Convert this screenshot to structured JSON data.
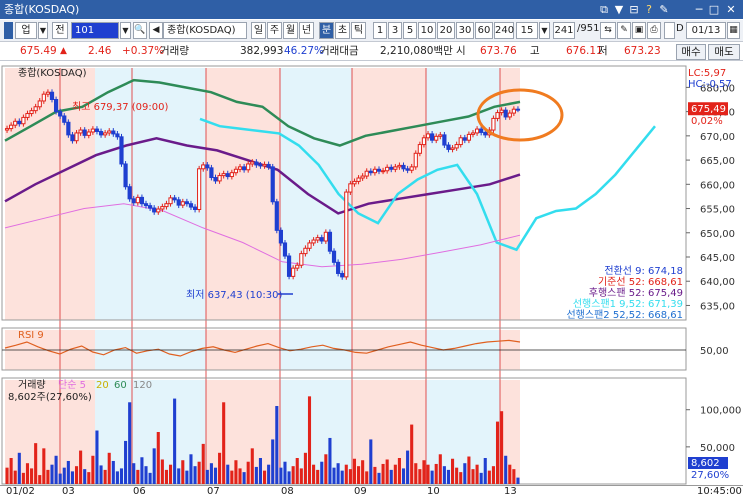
{
  "window": {
    "title": "종합(KOSDAQ)",
    "controls": [
      "⧉",
      "▼",
      "⊟",
      "?",
      "✎",
      "─",
      "□",
      "✕"
    ]
  },
  "toolbar": {
    "market": "업",
    "jeon": "전",
    "code": "101",
    "search_icon": "🔍",
    "name": "종합(KOSDAQ)",
    "periods": [
      "일",
      "주",
      "월",
      "년",
      "분",
      "초",
      "틱"
    ],
    "selected_period": "분",
    "intervals": [
      "1",
      "3",
      "5",
      "10",
      "20",
      "30",
      "60",
      "240"
    ],
    "interval_value": "15",
    "count_value": "241",
    "count_total": "/951",
    "checkbox_label": "D",
    "date_value": "01/13"
  },
  "quote": {
    "price": "675.49",
    "arrow": "▲",
    "change": "2.46",
    "change_pct": "+0.37%",
    "volume_label": "거래량",
    "volume": "382,993",
    "volume_ratio": "46.27%",
    "amount_label": "거래대금",
    "amount": "2,210,080백만",
    "open_label": "시",
    "open": "673.76",
    "high_label": "고",
    "high": "676.11",
    "low_label": "저",
    "low": "673.23",
    "buy_label": "매수",
    "sell_label": "매도"
  },
  "chart_data": [
    {
      "type": "candlestick",
      "title": "종합(KOSDAQ)",
      "ylim": [
        632,
        684
      ],
      "y_ticks": [
        "680,00",
        "675,00",
        "670,00",
        "665,00",
        "660,00",
        "655,00",
        "650,00",
        "645,00",
        "640,00",
        "635,00"
      ],
      "y_tick_values": [
        680,
        675,
        670,
        665,
        660,
        655,
        650,
        645,
        640,
        635
      ],
      "price_tag": "675,49",
      "price_tag_pct": "0,02%",
      "corner_labels": [
        "LC:5,97",
        "HC:-0,57"
      ],
      "annotations": {
        "high": "최고 679,37 (09:00)",
        "low": "최저 637,43 (10:30)"
      },
      "legend": [
        {
          "text": "전환선 9: 674,18",
          "color": "#1f3fd0"
        },
        {
          "text": "기준선 52: 668,61",
          "color": "#e2231a"
        },
        {
          "text": "후행스팬 52: 675,49",
          "color": "#6a1b8a"
        },
        {
          "text": "선행스팬1 9,52: 671,39",
          "color": "#33ddee"
        },
        {
          "text": "선행스팬2 52,52: 668,61",
          "color": "#1f6fd0"
        }
      ],
      "series": [
        {
          "name": "캔들",
          "values": [
            671.5,
            672.2,
            673.0,
            672.5,
            673.8,
            674.6,
            675.2,
            676.0,
            677.2,
            678.6,
            679.0,
            677.5,
            675.0,
            674.1,
            672.8,
            670.2,
            669.0,
            670.6,
            671.2,
            670.1,
            670.8,
            671.4,
            670.9,
            670.2,
            670.6,
            671.0,
            670.4,
            669.8,
            664.2,
            659.5,
            657.0,
            656.2,
            657.3,
            656.0,
            655.6,
            655.1,
            654.3,
            654.9,
            655.4,
            656.0,
            657.2,
            656.8,
            655.7,
            656.4,
            656.0,
            655.3,
            654.8,
            663.2,
            664.0,
            663.4,
            661.4,
            660.7,
            661.8,
            662.2,
            661.6,
            662.4,
            663.1,
            663.6,
            663.0,
            664.2,
            664.6,
            664.0,
            663.8,
            664.1,
            663.6,
            656.4,
            650.5,
            647.9,
            645.2,
            641.0,
            642.7,
            643.3,
            645.7,
            646.8,
            647.9,
            648.5,
            649.0,
            648.3,
            650.1,
            646.2,
            643.9,
            641.6,
            640.9,
            658.4,
            660.1,
            660.6,
            661.3,
            661.7,
            662.7,
            662.4,
            663.1,
            662.7,
            662.8,
            663.5,
            663.1,
            663.6,
            663.9,
            663.2,
            662.9,
            663.6,
            666.4,
            668.2,
            669.6,
            670.4,
            669.1,
            669.9,
            670.2,
            668.1,
            667.2,
            667.5,
            668.2,
            669.6,
            669.1,
            670.3,
            670.6,
            671.4,
            670.7,
            670.2,
            671.2,
            673.6,
            674.8,
            675.3,
            673.9,
            674.7,
            675.5,
            675.49
          ]
        },
        {
          "name": "기준선",
          "values": [
            669.0,
            672.0,
            675.0,
            676.0,
            679.0,
            681.5,
            681.0,
            680.0,
            679.0,
            677.0,
            676.0,
            672.0,
            669.5,
            668.0,
            670.0,
            671.0,
            672.0,
            673.0,
            674.0,
            676.0,
            677.0
          ]
        },
        {
          "name": "전환선",
          "values": [
            656.5,
            660.0,
            663.0,
            666.0,
            668.0,
            669.5,
            668.0,
            667.0,
            665.0,
            663.0,
            658.0,
            654.0,
            656.0,
            657.0,
            658.0,
            659.0,
            660.0,
            662.0
          ]
        },
        {
          "name": "선행스팬1",
          "values": [
            673.5,
            672.0,
            671.5,
            671.0,
            670.5,
            668.0,
            664.0,
            658.0,
            654.0,
            652.0,
            658.0,
            661.0,
            663.0,
            664.0,
            658.0,
            648.0,
            646.5,
            653.0,
            654.5,
            655.0,
            658.0,
            662.0,
            667.0,
            672.0
          ]
        },
        {
          "name": "선행스팬2",
          "values": [
            651.0,
            653.0,
            655.0,
            656.0,
            654.5,
            651.0,
            648.0,
            644.0,
            643.0,
            643.5,
            644.5,
            646.0,
            647.5,
            649.5
          ]
        }
      ]
    },
    {
      "type": "line",
      "title": "RSI 9",
      "ylim": [
        0,
        100
      ],
      "y_ticks": [
        "50,00"
      ],
      "series": [
        {
          "name": "RSI 9",
          "values": [
            55,
            62,
            70,
            58,
            48,
            40,
            52,
            60,
            45,
            38,
            50,
            56,
            42,
            48,
            52,
            40,
            35,
            46,
            54,
            58,
            50,
            44,
            52,
            60,
            66,
            56,
            48,
            52,
            58,
            62,
            54,
            50,
            44,
            42,
            50,
            58,
            64,
            70,
            62,
            56,
            50,
            54,
            60,
            66,
            70,
            72,
            74,
            70
          ]
        }
      ]
    },
    {
      "type": "bar",
      "title": "거래량",
      "legend_suffix": [
        "단순 5",
        "20",
        "60",
        "120"
      ],
      "subtitle": "8,602주(27,60%)",
      "ylim": [
        0,
        140000
      ],
      "y_ticks": [
        "100,000",
        "50,000"
      ],
      "value_tag": "8,602",
      "value_tag_pct": "27,60%",
      "series": [
        {
          "name": "거래량",
          "values": [
            22000,
            35000,
            18000,
            42000,
            15000,
            28000,
            21000,
            55000,
            12000,
            48000,
            19000,
            26000,
            38000,
            14000,
            22000,
            31000,
            17000,
            24000,
            45000,
            20000,
            16000,
            38000,
            72000,
            25000,
            19000,
            42000,
            31000,
            17000,
            21000,
            58000,
            110000,
            28000,
            19000,
            36000,
            24000,
            15000,
            48000,
            70000,
            33000,
            19000,
            26000,
            115000,
            21000,
            32000,
            18000,
            40000,
            24000,
            30000,
            54000,
            19000,
            28000,
            22000,
            42000,
            110000,
            26000,
            18000,
            32000,
            21000,
            16000,
            30000,
            48000,
            23000,
            35000,
            18000,
            26000,
            60000,
            105000,
            22000,
            30000,
            17000,
            24000,
            35000,
            21000,
            42000,
            118000,
            26000,
            19000,
            30000,
            40000,
            62000,
            22000,
            28000,
            18000,
            26000,
            20000,
            34000,
            24000,
            32000,
            17000,
            60000,
            23000,
            15000,
            27000,
            33000,
            19000,
            26000,
            35000,
            21000,
            45000,
            80000,
            28000,
            20000,
            32000,
            26000,
            18000,
            27000,
            40000,
            24000,
            19000,
            34000,
            22000,
            16000,
            28000,
            37000,
            20000,
            26000,
            15000,
            35000,
            18000,
            24000,
            84000,
            98000,
            38000,
            26000,
            20000,
            8602
          ]
        }
      ]
    }
  ],
  "xaxis": {
    "labels": [
      "01/02",
      "03",
      "06",
      "07",
      "08",
      "09",
      "10",
      "13"
    ],
    "time": "10:45:00"
  }
}
